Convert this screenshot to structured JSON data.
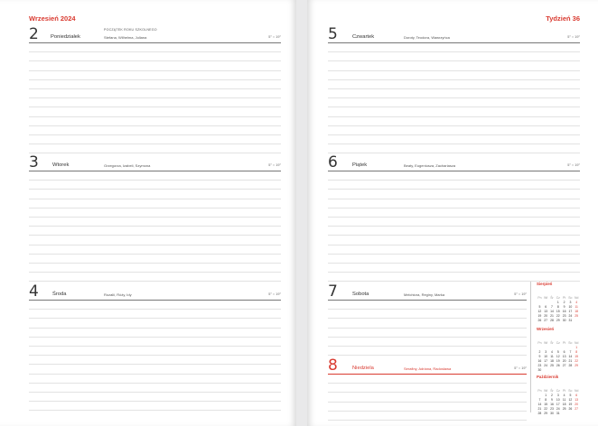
{
  "left_page": {
    "header": "Wrzesień 2024",
    "days": [
      {
        "num": "2",
        "name": "Poniedziałek",
        "event": "POCZĄTEK ROKU SZKOLNEGO",
        "names": "Stefana, Wilhelma, Juliana",
        "weather": "5°  ○  19°"
      },
      {
        "num": "3",
        "name": "Wtorek",
        "names": "Grzegorza, Izabeli, Szymona",
        "weather": "5°  ○  19°"
      },
      {
        "num": "4",
        "name": "Środa",
        "names": "Rozalii, Róży, Idy",
        "weather": "5°  ○  19°"
      }
    ]
  },
  "right_page": {
    "header": "Tydzień 36",
    "days": [
      {
        "num": "5",
        "name": "Czwartek",
        "names": "Doroty, Teodora, Wawrzyńca",
        "weather": "5°  ○  19°"
      },
      {
        "num": "6",
        "name": "Piątek",
        "names": "Beaty, Eugeniusza, Zachariasza",
        "weather": "5°  ○  19°"
      },
      {
        "num": "7",
        "name": "Sobota",
        "names": "Melchiora, Reginy, Marka",
        "weather": "5°  ○  19°"
      },
      {
        "num": "8",
        "name": "Niedziela",
        "names": "Serafiny, Adriana, Radosława",
        "weather": "5°  ○  19°"
      }
    ]
  },
  "mini_calendars": [
    {
      "title": "Sierpień",
      "weekdays": [
        "Pn",
        "Wt",
        "Śr",
        "Cz",
        "Pt",
        "So",
        "Nd"
      ],
      "weeks": [
        [
          "",
          "",
          "",
          "1",
          "2",
          "3",
          "4"
        ],
        [
          "5",
          "6",
          "7",
          "8",
          "9",
          "10",
          "11"
        ],
        [
          "12",
          "13",
          "14",
          "15",
          "16",
          "17",
          "18"
        ],
        [
          "19",
          "20",
          "21",
          "22",
          "23",
          "24",
          "25"
        ],
        [
          "26",
          "27",
          "28",
          "29",
          "30",
          "31",
          ""
        ]
      ]
    },
    {
      "title": "Wrzesień",
      "weekdays": [
        "Pn",
        "Wt",
        "Śr",
        "Cz",
        "Pt",
        "So",
        "Nd"
      ],
      "weeks": [
        [
          "",
          "",
          "",
          "",
          "",
          "",
          "1"
        ],
        [
          "2",
          "3",
          "4",
          "5",
          "6",
          "7",
          "8"
        ],
        [
          "9",
          "10",
          "11",
          "12",
          "13",
          "14",
          "15"
        ],
        [
          "16",
          "17",
          "18",
          "19",
          "20",
          "21",
          "22"
        ],
        [
          "23",
          "24",
          "25",
          "26",
          "27",
          "28",
          "29"
        ],
        [
          "30",
          "",
          "",
          "",
          "",
          "",
          ""
        ]
      ]
    },
    {
      "title": "Październik",
      "weekdays": [
        "Pn",
        "Wt",
        "Śr",
        "Cz",
        "Pt",
        "So",
        "Nd"
      ],
      "weeks": [
        [
          "",
          "1",
          "2",
          "3",
          "4",
          "5",
          "6"
        ],
        [
          "7",
          "8",
          "9",
          "10",
          "11",
          "12",
          "13"
        ],
        [
          "14",
          "15",
          "16",
          "17",
          "18",
          "19",
          "20"
        ],
        [
          "21",
          "22",
          "23",
          "24",
          "25",
          "26",
          "27"
        ],
        [
          "28",
          "29",
          "30",
          "31",
          "",
          "",
          ""
        ]
      ]
    }
  ]
}
